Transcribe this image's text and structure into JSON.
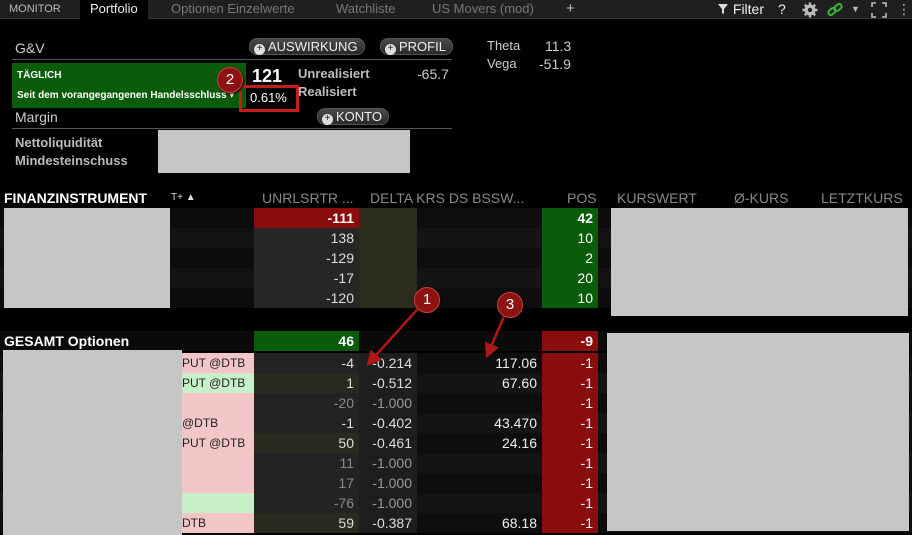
{
  "tabs": {
    "monitor": "MONITOR",
    "portfolio": "Portfolio",
    "options": "Optionen Einzelwerte",
    "watchlist": "Watchliste",
    "movers": "US Movers (mod)",
    "add": "+"
  },
  "toolbar": {
    "filter": "Filter",
    "help": "?"
  },
  "summary": {
    "gv_label": "G&V",
    "auswirkung": "AUSWIRKUNG",
    "profil": "PROFIL",
    "taeglich": "TÄGLICH",
    "since_label": "Seit dem vorangegangenen Handelsschluss ▾",
    "daily_value": "121",
    "daily_pct": "0.61%",
    "unrealized_label": "Unrealisiert",
    "unrealized_value": "-65.7",
    "realized_label": "Realisiert",
    "theta_label": "Theta",
    "theta_value": "11.3",
    "vega_label": "Vega",
    "vega_value": "-51.9",
    "margin_label": "Margin",
    "konto": "KONTO",
    "net_liq_label": "Nettoliquidität",
    "init_margin_label": "Mindesteinschuss"
  },
  "annotations": {
    "one": "1",
    "two": "2",
    "three": "3"
  },
  "table": {
    "headers": {
      "instrument": "FINANZINSTRUMENT",
      "sort": "T+ ▲",
      "unrl": "UNRLSRTR ...",
      "delta": "DELTA KRS DS BSSW...",
      "pos": "POS",
      "kurswert": "KURSWERT",
      "avg": "Ø-KURS",
      "last": "LETZTKURS"
    },
    "stock_rows": [
      {
        "unrl": "-111",
        "delta": "",
        "extra": "",
        "pos": "42"
      },
      {
        "unrl": "138",
        "delta": "",
        "extra": "",
        "pos": "10"
      },
      {
        "unrl": "-129",
        "delta": "",
        "extra": "",
        "pos": "2"
      },
      {
        "unrl": "-17",
        "delta": "",
        "extra": "",
        "pos": "20"
      },
      {
        "unrl": "-120",
        "delta": "",
        "extra": "",
        "pos": "10"
      }
    ],
    "total_label": "GESAMT Optionen",
    "total_unrl": "46",
    "total_pos": "-9",
    "option_rows": [
      {
        "name": "PUT @DTB",
        "unrl": "-4",
        "delta": "-0.214",
        "extra": "117.06",
        "pos": "-1"
      },
      {
        "name": "PUT @DTB",
        "unrl": "1",
        "delta": "-0.512",
        "extra": "67.60",
        "pos": "-1"
      },
      {
        "name": "",
        "unrl": "-20",
        "delta": "-1.000",
        "extra": "",
        "pos": "-1"
      },
      {
        "name": "@DTB",
        "unrl": "-1",
        "delta": "-0.402",
        "extra": "43.470",
        "pos": "-1"
      },
      {
        "name": "PUT @DTB",
        "unrl": "50",
        "delta": "-0.461",
        "extra": "24.16",
        "pos": "-1"
      },
      {
        "name": "",
        "unrl": "11",
        "delta": "-1.000",
        "extra": "",
        "pos": "-1"
      },
      {
        "name": "",
        "unrl": "17",
        "delta": "-1.000",
        "extra": "",
        "pos": "-1"
      },
      {
        "name": "",
        "unrl": "-76",
        "delta": "-1.000",
        "extra": "",
        "pos": "-1"
      },
      {
        "name": "DTB",
        "unrl": "59",
        "delta": "-0.387",
        "extra": "68.18",
        "pos": "-1"
      }
    ]
  }
}
